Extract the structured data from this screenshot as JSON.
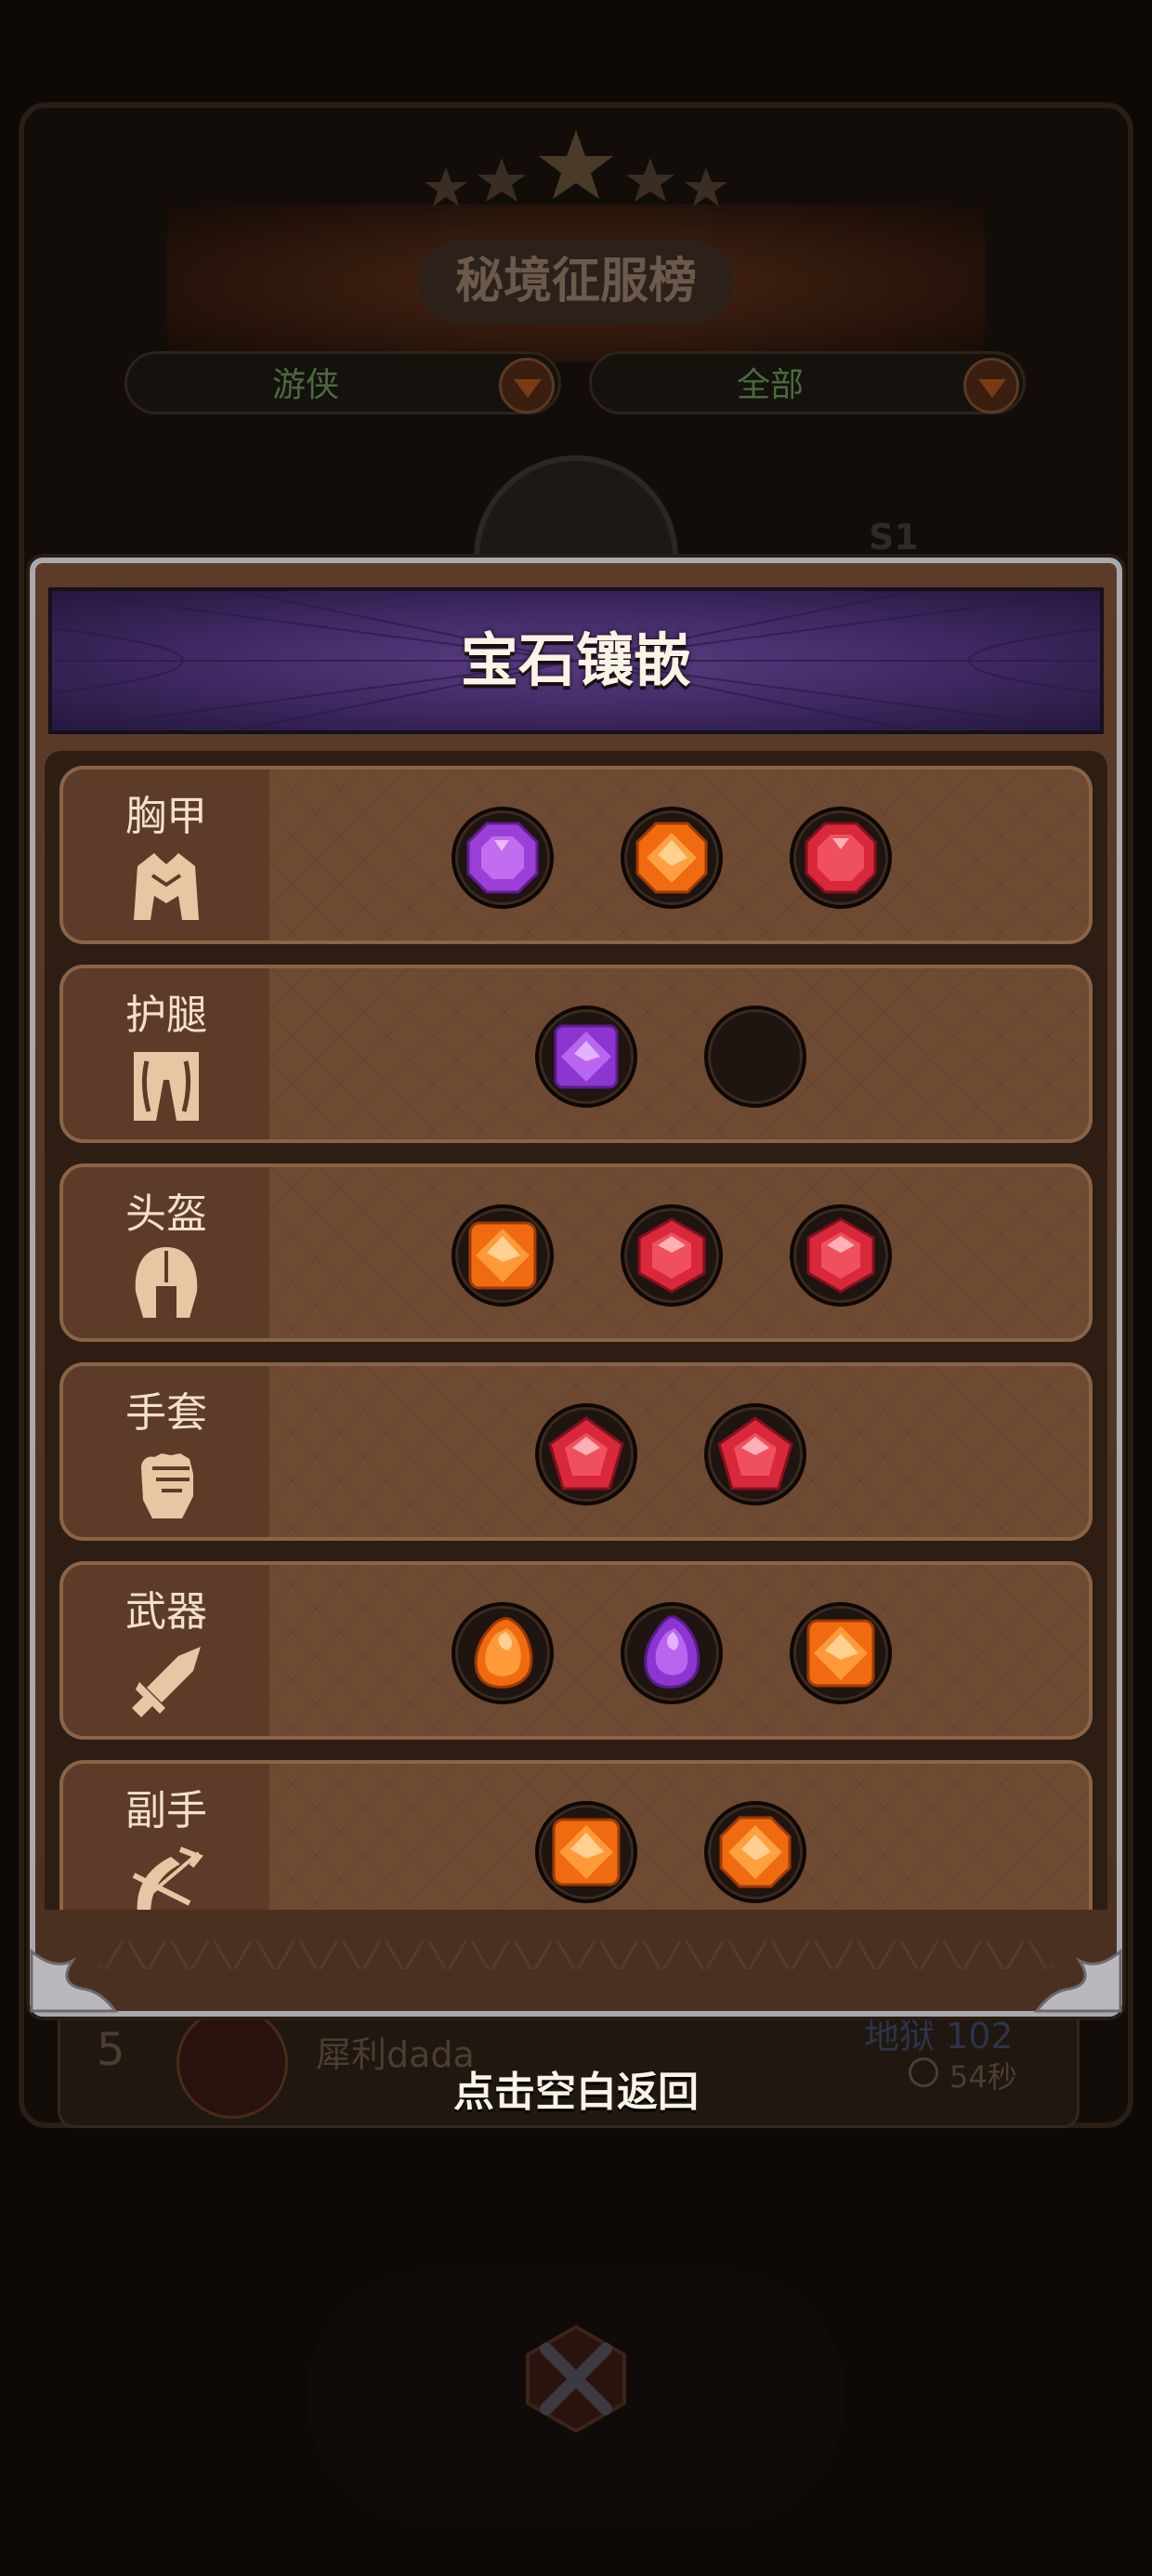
{
  "background": {
    "leaderboard_title": "秘境征服榜",
    "filter_class": "游侠",
    "filter_scope": "全部",
    "season_badge": "S1",
    "row": {
      "rank": "5",
      "player_name": "犀利dada",
      "level": "地狱 102",
      "time": "54秒"
    }
  },
  "popup": {
    "title": "宝石镶嵌",
    "hint": "点击空白返回",
    "slots": [
      {
        "name": "胸甲",
        "icon": "chest-armor-icon",
        "gems": [
          "purple-octagon",
          "orange-octagon",
          "red-octagon"
        ]
      },
      {
        "name": "护腿",
        "icon": "leg-armor-icon",
        "gems": [
          "purple-square",
          "empty"
        ]
      },
      {
        "name": "头盔",
        "icon": "helmet-icon",
        "gems": [
          "orange-square",
          "red-hexagon",
          "red-hexagon"
        ]
      },
      {
        "name": "手套",
        "icon": "fist-icon",
        "gems": [
          "red-pentagon",
          "red-pentagon"
        ]
      },
      {
        "name": "武器",
        "icon": "sword-icon",
        "gems": [
          "orange-drop",
          "purple-drop",
          "orange-square"
        ]
      },
      {
        "name": "副手",
        "icon": "bow-icon",
        "gems": [
          "orange-square",
          "orange-octagon"
        ]
      }
    ]
  },
  "colors": {
    "gem_purple": "#a84be0",
    "gem_orange": "#ff8a2a",
    "gem_red": "#e8374a",
    "label_text": "#f3e0c8",
    "header_purple": "#5b3c84"
  }
}
